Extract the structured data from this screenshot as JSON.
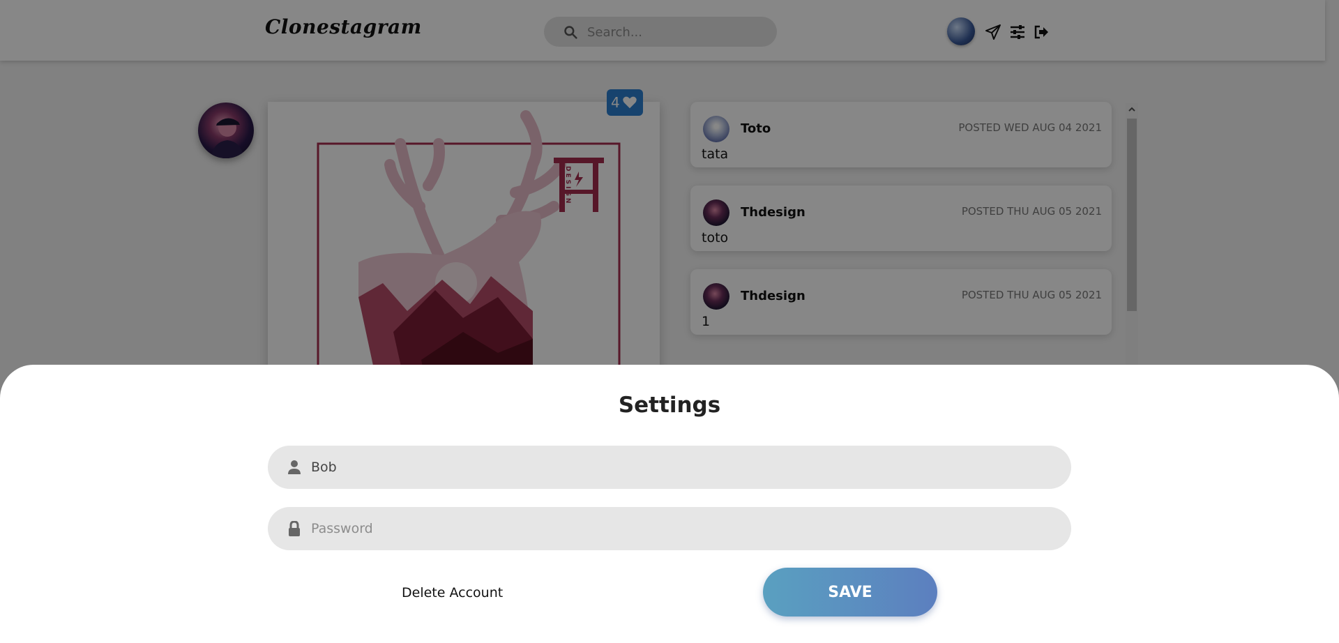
{
  "header": {
    "logo": "Clonestagram",
    "search_placeholder": "Search...",
    "icons": [
      "avatar",
      "send-icon",
      "settings-sliders-icon",
      "logout-icon"
    ]
  },
  "post": {
    "likes": "4",
    "like_icon": "heart-icon",
    "image_text": "DESIGN"
  },
  "comments": [
    {
      "name": "Toto",
      "date": "POSTED WED AUG 04 2021",
      "text": "tata"
    },
    {
      "name": "Thdesign",
      "date": "POSTED THU AUG 05 2021",
      "text": "toto"
    },
    {
      "name": "Thdesign",
      "date": "POSTED THU AUG 05 2021",
      "text": "1"
    }
  ],
  "settings": {
    "title": "Settings",
    "username_value": "Bob",
    "password_placeholder": "Password",
    "delete_label": "Delete Account",
    "save_label": "SAVE"
  },
  "colors": {
    "accent": "#2d7fd0",
    "save_gradient_start": "#5aa0c0",
    "save_gradient_end": "#5c7fbf",
    "poster_red": "#8a1d3a"
  }
}
